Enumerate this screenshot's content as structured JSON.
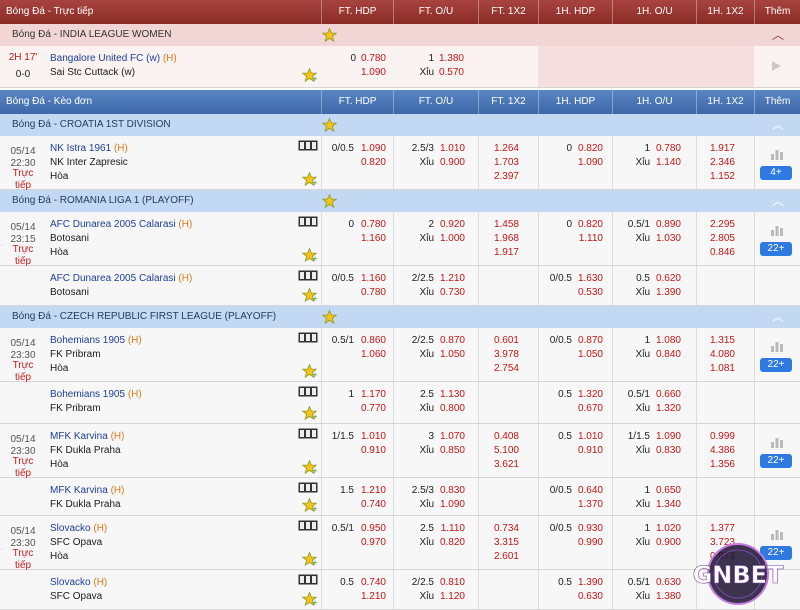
{
  "live_header": {
    "title": "Bóng Đá - Trực tiếp",
    "cols": [
      "FT. HDP",
      "FT. O/U",
      "FT. 1X2",
      "1H. HDP",
      "1H. O/U",
      "1H. 1X2",
      "Thêm"
    ]
  },
  "live_league": "Bóng Đá - INDIA LEAGUE WOMEN",
  "live_match": {
    "time": "2H 17'",
    "score": "0-0",
    "home": "Bangalore United FC (w)",
    "home_tag": "(H)",
    "away": "Sai Stc Cuttack (w)",
    "hdp_line": "0",
    "hdp_home": "0.780",
    "hdp_away": "1.090",
    "ou_line": "1",
    "ou_over": "1.380",
    "ou_under_label": "Xỉu",
    "ou_under": "0.570"
  },
  "prematch_header": {
    "title": "Bóng Đá - Kèo đơn",
    "cols": [
      "FT. HDP",
      "FT. O/U",
      "FT. 1X2",
      "1H. HDP",
      "1H. O/U",
      "1H. 1X2",
      "Thêm"
    ]
  },
  "leagues": {
    "croatia": "Bóng Đá - CROATIA 1ST DIVISION",
    "romania": "Bóng Đá - ROMANIA LIGA 1 (PLAYOFF)",
    "czech": "Bóng Đá - CZECH REPUBLIC FIRST LEAGUE (PLAYOFF)"
  },
  "live_label": "Trực tiếp",
  "home_tag": "(H)",
  "draw_label": "Hòa",
  "under_label": "Xỉu",
  "matches": [
    {
      "date": "05/14",
      "time": "22:30",
      "home": "NK Istra 1961",
      "away": "NK Inter Zapresic",
      "ft_hdp_line": "0/0.5",
      "ft_hdp_h": "1.090",
      "ft_hdp_a": "0.820",
      "ft_ou_line": "2.5/3",
      "ft_ou_o": "1.010",
      "ft_ou_u": "0.900",
      "ft_1": "1.264",
      "ft_x": "1.703",
      "ft_2": "2.397",
      "h1_hdp_line": "0",
      "h1_hdp_h": "0.820",
      "h1_hdp_a": "1.090",
      "h1_ou_line": "1",
      "h1_ou_o": "0.780",
      "h1_ou_u": "1.140",
      "h1_1": "1.917",
      "h1_x": "2.346",
      "h1_2": "1.152",
      "more": "4+"
    },
    {
      "date": "05/14",
      "time": "23:15",
      "home": "AFC Dunarea 2005 Calarasi",
      "away": "Botosani",
      "ft_hdp_line": "0",
      "ft_hdp_h": "0.780",
      "ft_hdp_a": "1.160",
      "ft_ou_line": "2",
      "ft_ou_o": "0.920",
      "ft_ou_u": "1.000",
      "ft_1": "1.458",
      "ft_x": "1.968",
      "ft_2": "1.917",
      "h1_hdp_line": "0",
      "h1_hdp_h": "0.820",
      "h1_hdp_a": "1.110",
      "h1_ou_line": "0.5/1",
      "h1_ou_o": "0.890",
      "h1_ou_u": "1.030",
      "h1_1": "2.295",
      "h1_x": "2.805",
      "h1_2": "0.846",
      "more": "22+"
    },
    {
      "home": "AFC Dunarea 2005 Calarasi",
      "away": "Botosani",
      "ft_hdp_line": "0/0.5",
      "ft_hdp_h": "1.160",
      "ft_hdp_a": "0.780",
      "ft_ou_line": "2/2.5",
      "ft_ou_o": "1.210",
      "ft_ou_u": "0.730",
      "h1_hdp_line": "0/0.5",
      "h1_hdp_h": "1.630",
      "h1_hdp_a": "0.530",
      "h1_ou_line": "0.5",
      "h1_ou_o": "0.620",
      "h1_ou_u": "1.390"
    },
    {
      "date": "05/14",
      "time": "23:30",
      "home": "Bohemians 1905",
      "away": "FK Pribram",
      "ft_hdp_line": "0.5/1",
      "ft_hdp_h": "0.860",
      "ft_hdp_a": "1.060",
      "ft_ou_line": "2/2.5",
      "ft_ou_o": "0.870",
      "ft_ou_u": "1.050",
      "ft_1": "0.601",
      "ft_x": "3.978",
      "ft_2": "2.754",
      "h1_hdp_line": "0/0.5",
      "h1_hdp_h": "0.870",
      "h1_hdp_a": "1.050",
      "h1_ou_line": "1",
      "h1_ou_o": "1.080",
      "h1_ou_u": "0.840",
      "h1_1": "1.315",
      "h1_x": "4.080",
      "h1_2": "1.081",
      "more": "22+"
    },
    {
      "home": "Bohemians 1905",
      "away": "FK Pribram",
      "ft_hdp_line": "1",
      "ft_hdp_h": "1.170",
      "ft_hdp_a": "0.770",
      "ft_ou_line": "2.5",
      "ft_ou_o": "1.130",
      "ft_ou_u": "0.800",
      "h1_hdp_line": "0.5",
      "h1_hdp_h": "1.320",
      "h1_hdp_a": "0.670",
      "h1_ou_line": "0.5/1",
      "h1_ou_o": "0.660",
      "h1_ou_u": "1.320"
    },
    {
      "date": "05/14",
      "time": "23:30",
      "home": "MFK Karvina",
      "away": "FK Dukla Praha",
      "ft_hdp_line": "1/1.5",
      "ft_hdp_h": "1.010",
      "ft_hdp_a": "0.910",
      "ft_ou_line": "3",
      "ft_ou_o": "1.070",
      "ft_ou_u": "0.850",
      "ft_1": "0.408",
      "ft_x": "5.100",
      "ft_2": "3.621",
      "h1_hdp_line": "0.5",
      "h1_hdp_h": "1.010",
      "h1_hdp_a": "0.910",
      "h1_ou_line": "1/1.5",
      "h1_ou_o": "1.090",
      "h1_ou_u": "0.830",
      "h1_1": "0.999",
      "h1_x": "4.386",
      "h1_2": "1.356",
      "more": "22+"
    },
    {
      "home": "MFK Karvina",
      "away": "FK Dukla Praha",
      "ft_hdp_line": "1.5",
      "ft_hdp_h": "1.210",
      "ft_hdp_a": "0.740",
      "ft_ou_line": "2.5/3",
      "ft_ou_o": "0.830",
      "ft_ou_u": "1.090",
      "h1_hdp_line": "0/0.5",
      "h1_hdp_h": "0.640",
      "h1_hdp_a": "1.370",
      "h1_ou_line": "1",
      "h1_ou_o": "0.650",
      "h1_ou_u": "1.340"
    },
    {
      "date": "05/14",
      "time": "23:30",
      "home": "Slovacko",
      "away": "SFC Opava",
      "ft_hdp_line": "0.5/1",
      "ft_hdp_h": "0.950",
      "ft_hdp_a": "0.970",
      "ft_ou_line": "2.5",
      "ft_ou_o": "1.110",
      "ft_ou_u": "0.820",
      "ft_1": "0.734",
      "ft_x": "3.315",
      "ft_2": "2.601",
      "h1_hdp_line": "0/0.5",
      "h1_hdp_h": "0.930",
      "h1_hdp_a": "0.990",
      "h1_ou_line": "1",
      "h1_ou_o": "1.020",
      "h1_ou_u": "0.900",
      "h1_1": "1.377",
      "h1_x": "3.723",
      "h1_2": "0.973",
      "more": "22+"
    },
    {
      "home": "Slovacko",
      "away": "SFC Opava",
      "ft_hdp_line": "0.5",
      "ft_hdp_h": "0.740",
      "ft_hdp_a": "1.210",
      "ft_ou_line": "2/2.5",
      "ft_ou_o": "0.810",
      "ft_ou_u": "1.120",
      "h1_hdp_line": "0.5",
      "h1_hdp_h": "1.390",
      "h1_hdp_a": "0.630",
      "h1_ou_line": "0.5/1",
      "h1_ou_o": "0.630",
      "h1_ou_u": "1.380"
    }
  ],
  "logo_text": "GNBET",
  "colors": {
    "odds": "#c31616",
    "team": "#1d3f9a",
    "live": "#c51a1a",
    "header_live": "#9a3531",
    "header_main": "#4a76b8",
    "more_button": "#2f7ae0"
  }
}
